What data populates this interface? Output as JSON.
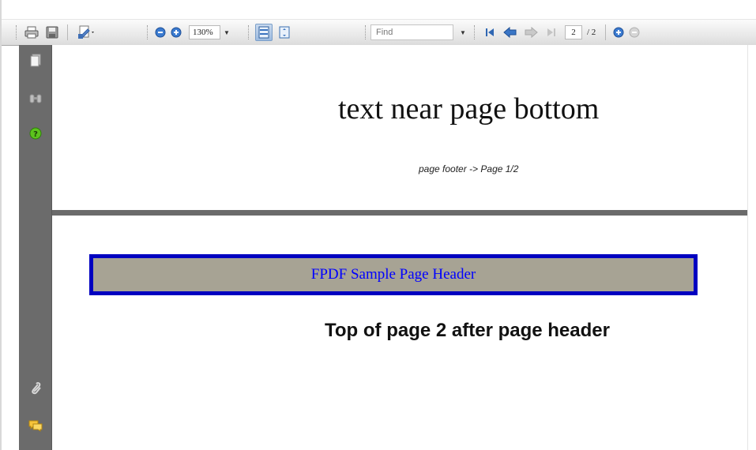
{
  "toolbar": {
    "zoom_value": "130%",
    "find_placeholder": "Find",
    "current_page": "2",
    "page_total": "/ 2",
    "icons": [
      "print-icon",
      "save-icon",
      "sign-icon",
      "zoom-out-icon",
      "zoom-in-icon",
      "fit-width-icon",
      "fit-page-icon",
      "first-page-icon",
      "prev-page-icon",
      "next-page-icon",
      "last-page-icon",
      "zoom-plus-icon",
      "zoom-minus-icon"
    ]
  },
  "navpane": {
    "icons": [
      "pages-icon",
      "binoculars-search-icon",
      "help-icon",
      "attachment-icon",
      "comments-icon"
    ]
  },
  "document": {
    "page1_text": "text near page bottom",
    "page1_footer": "page footer -> Page 1/2",
    "page2_header": "FPDF Sample Page Header",
    "page2_top_text": "Top of page 2 after page header"
  },
  "colors": {
    "header_border": "#0000c0",
    "header_fill": "#a7a394",
    "header_text": "#0000ff",
    "nav_background": "#6b6b6b"
  }
}
